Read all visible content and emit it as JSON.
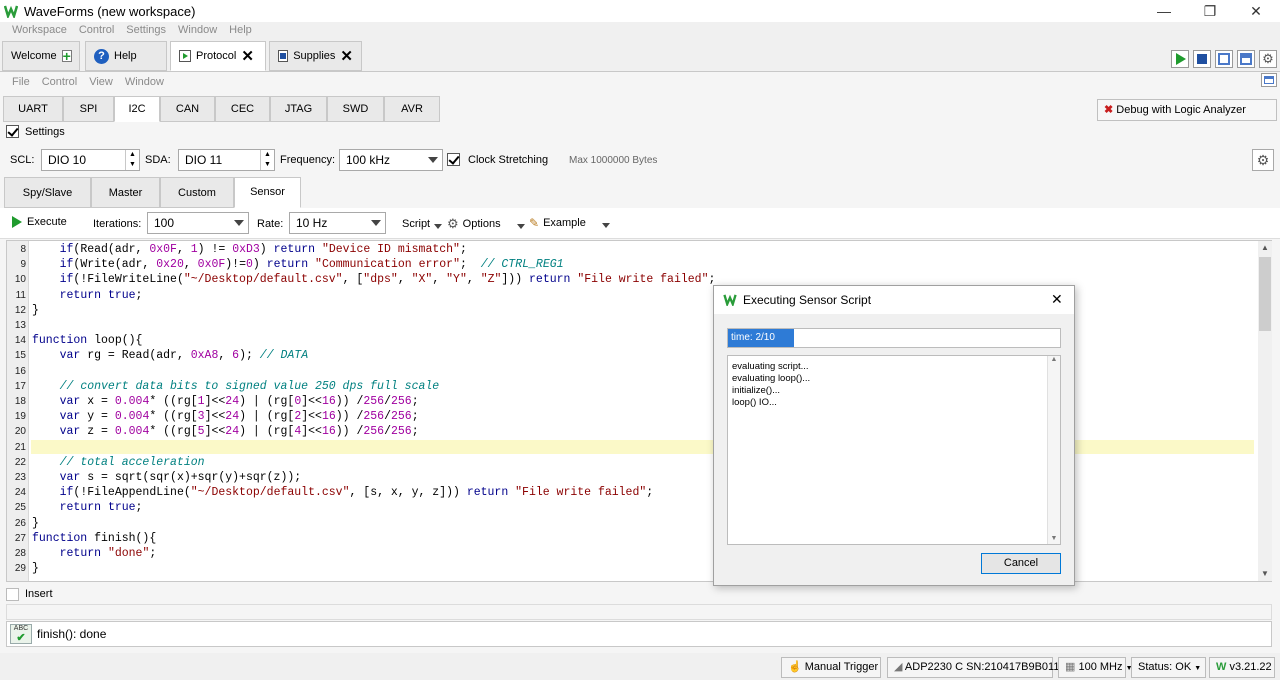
{
  "window": {
    "title": "WaveForms (new workspace)",
    "minimize": "—",
    "restore": "❐",
    "close": "✕"
  },
  "app_menu": [
    "Workspace",
    "Control",
    "Settings",
    "Window",
    "Help"
  ],
  "doc_tabs": [
    {
      "label": "Welcome",
      "active": false
    },
    {
      "label": "Help",
      "active": false
    },
    {
      "label": "Protocol",
      "active": true
    },
    {
      "label": "Supplies",
      "active": false
    }
  ],
  "inst_menu": [
    "File",
    "Control",
    "View",
    "Window"
  ],
  "protocol_tabs": [
    "UART",
    "SPI",
    "I2C",
    "CAN",
    "CEC",
    "JTAG",
    "SWD",
    "AVR"
  ],
  "active_protocol": "I2C",
  "debug_button": "Debug with Logic Analyzer",
  "settings": {
    "label": "Settings",
    "checked": true,
    "scl_label": "SCL:",
    "scl_value": "DIO 10",
    "sda_label": "SDA:",
    "sda_value": "DIO 11",
    "freq_label": "Frequency:",
    "freq_value": "100 kHz",
    "clock_stretching": "Clock Stretching",
    "max_bytes": "Max 1000000 Bytes"
  },
  "mode_tabs": [
    "Spy/Slave",
    "Master",
    "Custom",
    "Sensor"
  ],
  "active_mode": "Sensor",
  "toolbar": {
    "execute": "Execute",
    "iterations_label": "Iterations:",
    "iterations_value": "100",
    "rate_label": "Rate:",
    "rate_value": "10 Hz",
    "script": "Script",
    "options": "Options",
    "example": "Example"
  },
  "code_lines": [
    {
      "n": "8",
      "html": "    <span class=\"kw\">if</span>(Read(adr, <span class=\"num\">0x0F</span>, <span class=\"num\">1</span>) != <span class=\"num\">0xD3</span>) <span class=\"kw\">return</span> <span class=\"str\">\"Device ID mismatch\"</span>;"
    },
    {
      "n": "9",
      "html": "    <span class=\"kw\">if</span>(Write(adr, <span class=\"num\">0x20</span>, <span class=\"num\">0x0F</span>)!=<span class=\"num\">0</span>) <span class=\"kw\">return</span> <span class=\"str\">\"Communication error\"</span>;  <span class=\"cm\">// CTRL_REG1</span>"
    },
    {
      "n": "10",
      "html": "    <span class=\"kw\">if</span>(!FileWriteLine(<span class=\"str\">\"~/Desktop/default.csv\"</span>, [<span class=\"str\">\"dps\"</span>, <span class=\"str\">\"X\"</span>, <span class=\"str\">\"Y\"</span>, <span class=\"str\">\"Z\"</span>])) <span class=\"kw\">return</span> <span class=\"str\">\"File write failed\"</span>;"
    },
    {
      "n": "11",
      "html": "    <span class=\"kw\">return</span> <span class=\"kw\">true</span>;"
    },
    {
      "n": "12",
      "html": "}"
    },
    {
      "n": "13",
      "html": ""
    },
    {
      "n": "14",
      "html": "<span class=\"kw\">function</span> loop(){"
    },
    {
      "n": "15",
      "html": "    <span class=\"kw\">var</span> rg = Read(adr, <span class=\"num\">0xA8</span>, <span class=\"num\">6</span>); <span class=\"cm\">// DATA</span>"
    },
    {
      "n": "16",
      "html": ""
    },
    {
      "n": "17",
      "html": "    <span class=\"cm\">// convert data bits to signed value 250 dps full scale</span>"
    },
    {
      "n": "18",
      "html": "    <span class=\"kw\">var</span> x = <span class=\"num\">0.004</span>* ((rg[<span class=\"num\">1</span>]&lt;&lt;<span class=\"num\">24</span>) | (rg[<span class=\"num\">0</span>]&lt;&lt;<span class=\"num\">16</span>)) /<span class=\"num\">256</span>/<span class=\"num\">256</span>;"
    },
    {
      "n": "19",
      "html": "    <span class=\"kw\">var</span> y = <span class=\"num\">0.004</span>* ((rg[<span class=\"num\">3</span>]&lt;&lt;<span class=\"num\">24</span>) | (rg[<span class=\"num\">2</span>]&lt;&lt;<span class=\"num\">16</span>)) /<span class=\"num\">256</span>/<span class=\"num\">256</span>;"
    },
    {
      "n": "20",
      "html": "    <span class=\"kw\">var</span> z = <span class=\"num\">0.004</span>* ((rg[<span class=\"num\">5</span>]&lt;&lt;<span class=\"num\">24</span>) | (rg[<span class=\"num\">4</span>]&lt;&lt;<span class=\"num\">16</span>)) /<span class=\"num\">256</span>/<span class=\"num\">256</span>;"
    },
    {
      "n": "21",
      "html": ""
    },
    {
      "n": "22",
      "html": "    <span class=\"cm\">// total acceleration</span>"
    },
    {
      "n": "23",
      "html": "    <span class=\"kw\">var</span> s = sqrt(sqr(x)+sqr(y)+sqr(z));"
    },
    {
      "n": "24",
      "html": "    <span class=\"kw\">if</span>(!FileAppendLine(<span class=\"str\">\"~/Desktop/default.csv\"</span>, [s, x, y, z])) <span class=\"kw\">return</span> <span class=\"str\">\"File write failed\"</span>;"
    },
    {
      "n": "25",
      "html": "    <span class=\"kw\">return</span> <span class=\"kw\">true</span>;"
    },
    {
      "n": "26",
      "html": "}"
    },
    {
      "n": "27",
      "html": "<span class=\"kw\">function</span> finish(){"
    },
    {
      "n": "28",
      "html": "    <span class=\"kw\">return</span> <span class=\"str\">\"done\"</span>;"
    },
    {
      "n": "29",
      "html": "}"
    }
  ],
  "current_line": "21",
  "insert_label": "Insert",
  "status_message": "finish(): done",
  "dialog": {
    "title": "Executing Sensor Script",
    "progress_text": "time: 2/10",
    "progress_fraction": 0.2,
    "log": [
      "evaluating script...",
      "evaluating loop()...",
      "initialize()...",
      "loop() IO..."
    ],
    "cancel": "Cancel"
  },
  "statusbar": {
    "manual_trigger": "Manual Trigger",
    "device": "ADP2230 C SN:210417B9B011",
    "clock": "100 MHz",
    "status": "Status: OK",
    "version": "v3.21.22"
  },
  "colors": {
    "accent": "#1f9b2e",
    "progress": "#2e7bd6",
    "highlight": "#fbf9c8"
  }
}
